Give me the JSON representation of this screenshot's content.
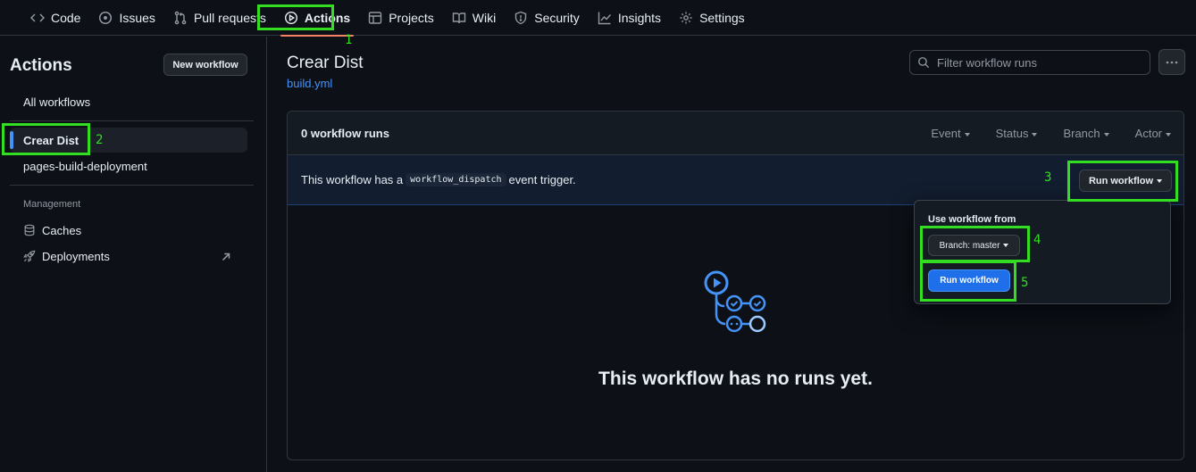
{
  "nav": {
    "tabs": [
      {
        "label": "Code",
        "icon": "code-icon"
      },
      {
        "label": "Issues",
        "icon": "issue-icon"
      },
      {
        "label": "Pull requests",
        "icon": "pull-request-icon"
      },
      {
        "label": "Actions",
        "icon": "play-icon",
        "active": true
      },
      {
        "label": "Projects",
        "icon": "table-icon"
      },
      {
        "label": "Wiki",
        "icon": "book-icon"
      },
      {
        "label": "Security",
        "icon": "shield-icon"
      },
      {
        "label": "Insights",
        "icon": "graph-icon"
      },
      {
        "label": "Settings",
        "icon": "gear-icon"
      }
    ]
  },
  "sidebar": {
    "title": "Actions",
    "new_workflow": "New workflow",
    "all_workflows": "All workflows",
    "workflows": [
      "Crear Dist",
      "pages-build-deployment"
    ],
    "management_label": "Management",
    "management": [
      {
        "label": "Caches",
        "icon": "database-icon"
      },
      {
        "label": "Deployments",
        "icon": "rocket-icon"
      }
    ]
  },
  "main": {
    "title": "Crear Dist",
    "file": "build.yml",
    "filter_placeholder": "Filter workflow runs",
    "runs_count": "0 workflow runs",
    "filters": [
      "Event",
      "Status",
      "Branch",
      "Actor"
    ],
    "dispatch_prefix": "This workflow has a",
    "dispatch_code": "workflow_dispatch",
    "dispatch_suffix": "event trigger.",
    "run_workflow": "Run workflow",
    "empty": "This workflow has no runs yet."
  },
  "dropdown": {
    "label": "Use workflow from",
    "branch": "Branch: master",
    "run": "Run workflow"
  },
  "annotations": [
    "1",
    "2",
    "3",
    "4",
    "5"
  ],
  "colors": {
    "highlight": "#33dd22",
    "accent": "#4493f8",
    "primary": "#1f6feb",
    "tab_underline": "#f78166"
  }
}
